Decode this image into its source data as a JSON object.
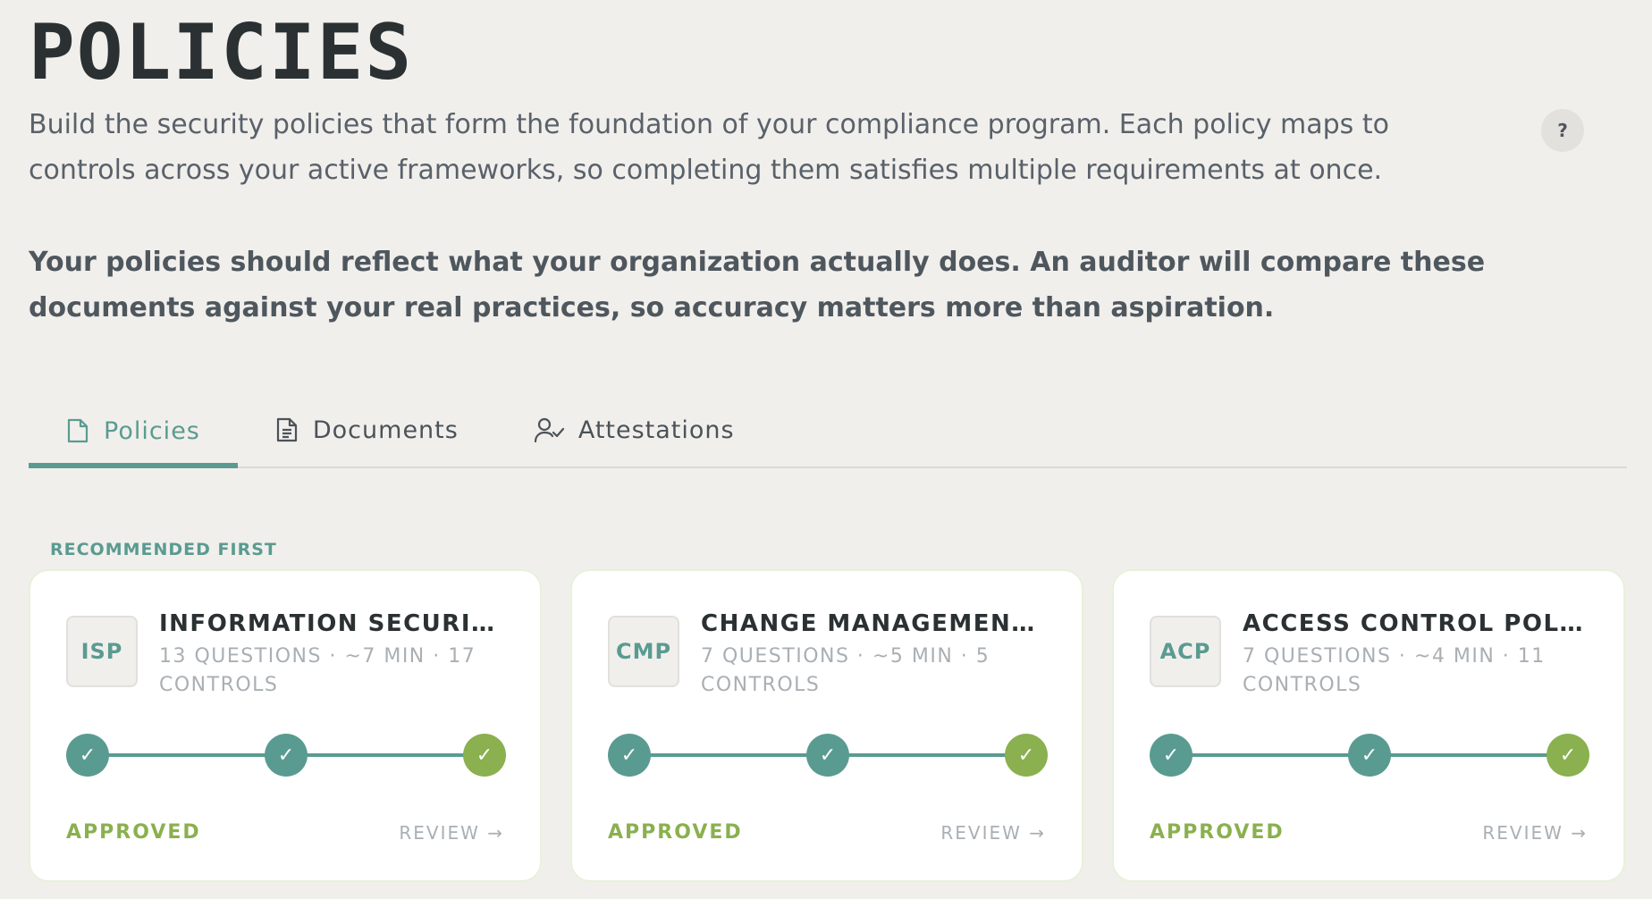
{
  "header": {
    "title": "POLICIES",
    "intro": "Build the security policies that form the foundation of your compliance program. Each policy maps to controls across your active frameworks, so completing them satisfies multiple requirements at once.",
    "emphasis": "Your policies should reflect what your organization actually does. An auditor will compare these documents against your real practices, so accuracy matters more than aspiration.",
    "help_label": "?"
  },
  "tabs": [
    {
      "label": "Policies",
      "icon": "file-icon",
      "active": true
    },
    {
      "label": "Documents",
      "icon": "document-text-icon",
      "active": false
    },
    {
      "label": "Attestations",
      "icon": "user-check-icon",
      "active": false
    }
  ],
  "section": {
    "label": "RECOMMENDED FIRST"
  },
  "cards": [
    {
      "badge": "ISP",
      "title": "INFORMATION SECURITY…",
      "meta": "13 QUESTIONS · ~7 MIN · 17 CONTROLS",
      "steps": [
        "✓",
        "✓",
        "✓"
      ],
      "status": "APPROVED",
      "action": "REVIEW →"
    },
    {
      "badge": "CMP",
      "title": "CHANGE MANAGEMENT …",
      "meta": "7 QUESTIONS · ~5 MIN · 5 CONTROLS",
      "steps": [
        "✓",
        "✓",
        "✓"
      ],
      "status": "APPROVED",
      "action": "REVIEW →"
    },
    {
      "badge": "ACP",
      "title": "ACCESS CONTROL POLI…",
      "meta": "7 QUESTIONS · ~4 MIN · 11 CONTROLS",
      "steps": [
        "✓",
        "✓",
        "✓"
      ],
      "status": "APPROVED",
      "action": "REVIEW →"
    }
  ],
  "colors": {
    "accent": "#5a9b91",
    "success": "#8ab04f",
    "background": "#f1efec"
  }
}
